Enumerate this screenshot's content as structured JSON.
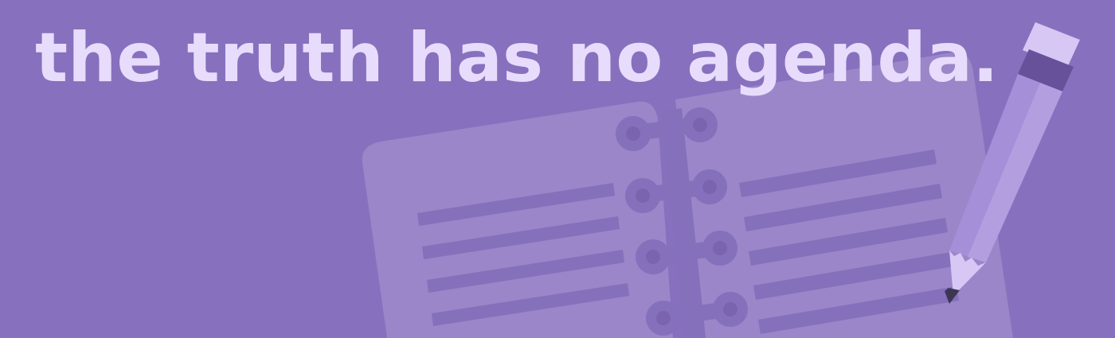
{
  "headline": "the truth has no agenda.",
  "colors": {
    "background": "#8770be",
    "headline": "#e7dcfb",
    "notebook_page": "#9a86c8",
    "notebook_lines": "#8570bc",
    "spiral": "#8570bc",
    "pencil_body": "#a68fd9",
    "pencil_eraser": "#d6c7f4",
    "pencil_band": "#66519a",
    "pencil_tip": "#d6c7f4",
    "pencil_lead": "#3e3553"
  },
  "illustration": {
    "notebook_icon": "spiral-notebook",
    "pencil_icon": "pencil"
  }
}
